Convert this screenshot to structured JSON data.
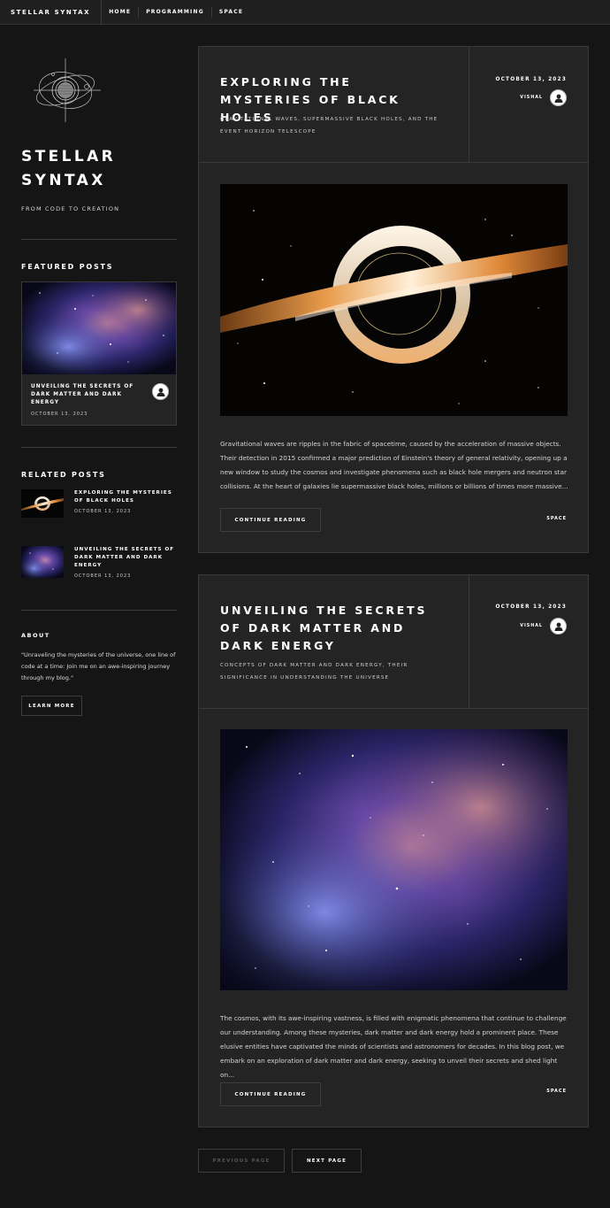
{
  "nav": {
    "brand": "STELLAR SYNTAX",
    "items": [
      "HOME",
      "PROGRAMMING",
      "SPACE"
    ]
  },
  "sidebar": {
    "site_title": "STELLAR SYNTAX",
    "tagline": "FROM CODE TO CREATION",
    "featured_heading": "FEATURED POSTS",
    "featured": {
      "title": "UNVEILING THE SECRETS OF DARK MATTER AND DARK ENERGY",
      "date": "OCTOBER 13, 2023"
    },
    "related_heading": "RELATED POSTS",
    "related": [
      {
        "title": "EXPLORING THE MYSTERIES OF BLACK HOLES",
        "date": "OCTOBER 13, 2023"
      },
      {
        "title": "UNVEILING THE SECRETS OF DARK MATTER AND DARK ENERGY",
        "date": "OCTOBER 13, 2023"
      }
    ],
    "about_heading": "ABOUT",
    "about_text": "\"Unraveling the mysteries of the universe, one line of code at a time: Join me on an awe-inspiring journey through my blog.\"",
    "learn_more": "LEARN MORE"
  },
  "posts": [
    {
      "title": "EXPLORING THE MYSTERIES OF BLACK HOLES",
      "subtitle": "GRAVITATIONAL WAVES, SUPERMASSIVE BLACK HOLES, AND THE EVENT HORIZON TELESCOPE",
      "date": "OCTOBER 13, 2023",
      "author": "VISHAL",
      "excerpt": "Gravitational waves are ripples in the fabric of spacetime, caused by the acceleration of massive objects. Their detection in 2015 confirmed a major prediction of Einstein's theory of general relativity, opening up a new window to study the cosmos and investigate phenomena such as black hole mergers and neutron star collisions. At the heart of galaxies lie supermassive black holes, millions or billions of times more massive...",
      "continue": "CONTINUE READING",
      "tag": "SPACE"
    },
    {
      "title": "UNVEILING THE SECRETS OF DARK MATTER AND DARK ENERGY",
      "subtitle": "CONCEPTS OF DARK MATTER AND DARK ENERGY, THEIR SIGNIFICANCE IN UNDERSTANDING THE UNIVERSE",
      "date": "OCTOBER 13, 2023",
      "author": "VISHAL",
      "excerpt": "The cosmos, with its awe-inspiring vastness, is filled with enigmatic phenomena that continue to challenge our understanding. Among these mysteries, dark matter and dark energy hold a prominent place. These elusive entities have captivated the minds of scientists and astronomers for decades. In this blog post, we embark on an exploration of dark matter and dark energy, seeking to unveil their secrets and shed light on...",
      "continue": "CONTINUE READING",
      "tag": "SPACE"
    }
  ],
  "pagination": {
    "previous": "PREVIOUS PAGE",
    "next": "NEXT PAGE"
  },
  "colors": {
    "background": "#151515",
    "card": "#242424",
    "border": "#3a3a3a",
    "text": "#ffffff"
  }
}
